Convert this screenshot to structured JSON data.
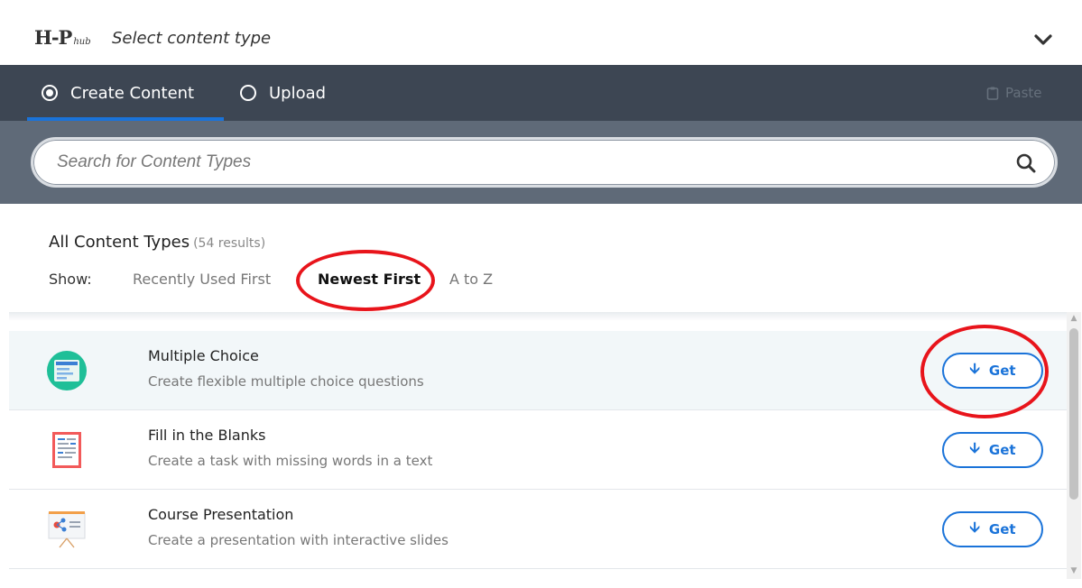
{
  "header": {
    "logo_main": "H-P",
    "logo_sub": "hub",
    "title": "Select content type"
  },
  "tabs": {
    "create_label": "Create Content",
    "upload_label": "Upload",
    "paste_label": "Paste"
  },
  "search": {
    "placeholder": "Search for Content Types"
  },
  "results": {
    "title": "All Content Types",
    "count": "(54 results)",
    "show_label": "Show:",
    "sort_options": [
      "Recently Used First",
      "Newest First",
      "A to Z"
    ],
    "selected_sort": "Newest First"
  },
  "items": [
    {
      "title": "Multiple Choice",
      "description": "Create flexible multiple choice questions",
      "button": "Get",
      "icon": "multiple-choice-icon",
      "selected": true
    },
    {
      "title": "Fill in the Blanks",
      "description": "Create a task with missing words in a text",
      "button": "Get",
      "icon": "fill-in-the-blanks-icon",
      "selected": false
    },
    {
      "title": "Course Presentation",
      "description": "Create a presentation with interactive slides",
      "button": "Get",
      "icon": "course-presentation-icon",
      "selected": false
    }
  ],
  "colors": {
    "tabbar": "#3d4653",
    "searchband": "#5f6a78",
    "accent": "#1a73d9",
    "highlight_ring": "#e8141b"
  }
}
